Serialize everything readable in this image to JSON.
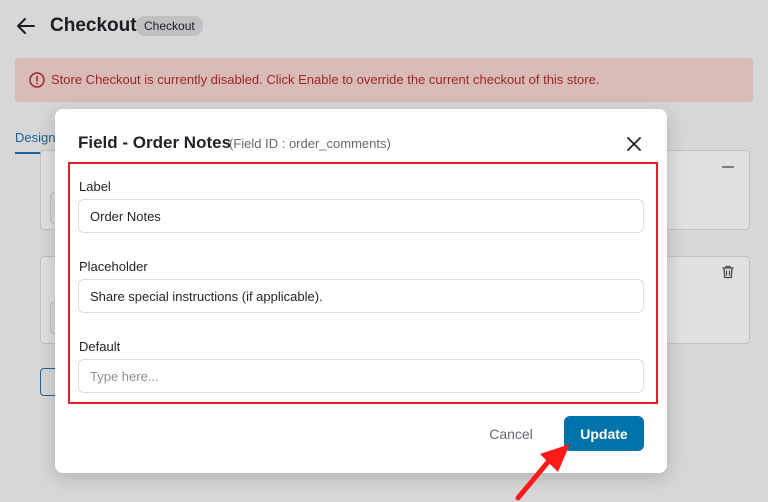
{
  "header": {
    "title": "Checkout",
    "badge": "Checkout"
  },
  "notice": {
    "text": "Store Checkout is currently disabled. Click Enable to override the current checkout of this store."
  },
  "tabs": {
    "design": "Design"
  },
  "modal": {
    "title": "Field - Order Notes",
    "subtitle": "(Field ID : order_comments)",
    "fields": [
      {
        "label": "Label",
        "value": "Order Notes",
        "placeholder": ""
      },
      {
        "label": "Placeholder",
        "value": "Share special instructions (if applicable).",
        "placeholder": ""
      },
      {
        "label": "Default",
        "value": "",
        "placeholder": "Type here..."
      }
    ],
    "cancel_label": "Cancel",
    "update_label": "Update"
  },
  "colors": {
    "accent": "#0073aa",
    "highlight": "#e2222b",
    "notice_bg": "#f7d6d2",
    "notice_text": "#b32d2e"
  },
  "icons": {
    "back": "arrow-left-icon",
    "notice": "info-circle-icon",
    "close": "close-icon",
    "trash": "trash-icon",
    "annotation": "red-arrow-icon"
  }
}
